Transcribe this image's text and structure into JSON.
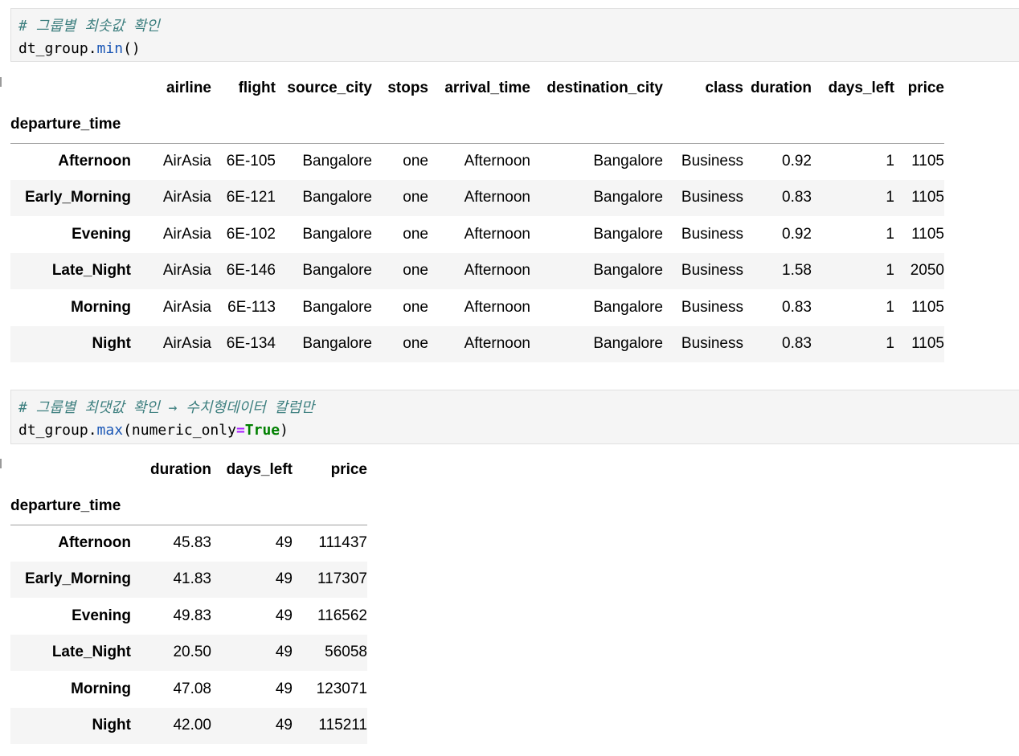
{
  "cell1": {
    "comment": "# 그룹별 최솟값 확인",
    "code_obj": "dt_group.",
    "code_fn": "min",
    "code_rest": "()"
  },
  "table1": {
    "columns": [
      "airline",
      "flight",
      "source_city",
      "stops",
      "arrival_time",
      "destination_city",
      "class",
      "duration",
      "days_left",
      "price"
    ],
    "index_name": "departure_time",
    "rows": [
      {
        "index": "Afternoon",
        "values": [
          "AirAsia",
          "6E-105",
          "Bangalore",
          "one",
          "Afternoon",
          "Bangalore",
          "Business",
          "0.92",
          "1",
          "1105"
        ]
      },
      {
        "index": "Early_Morning",
        "values": [
          "AirAsia",
          "6E-121",
          "Bangalore",
          "one",
          "Afternoon",
          "Bangalore",
          "Business",
          "0.83",
          "1",
          "1105"
        ]
      },
      {
        "index": "Evening",
        "values": [
          "AirAsia",
          "6E-102",
          "Bangalore",
          "one",
          "Afternoon",
          "Bangalore",
          "Business",
          "0.92",
          "1",
          "1105"
        ]
      },
      {
        "index": "Late_Night",
        "values": [
          "AirAsia",
          "6E-146",
          "Bangalore",
          "one",
          "Afternoon",
          "Bangalore",
          "Business",
          "1.58",
          "1",
          "2050"
        ]
      },
      {
        "index": "Morning",
        "values": [
          "AirAsia",
          "6E-113",
          "Bangalore",
          "one",
          "Afternoon",
          "Bangalore",
          "Business",
          "0.83",
          "1",
          "1105"
        ]
      },
      {
        "index": "Night",
        "values": [
          "AirAsia",
          "6E-134",
          "Bangalore",
          "one",
          "Afternoon",
          "Bangalore",
          "Business",
          "0.83",
          "1",
          "1105"
        ]
      }
    ]
  },
  "cell2": {
    "comment": "# 그룹별 최댓값 확인 → 수치형데이터 칼럼만",
    "code_obj": "dt_group.",
    "code_fn": "max",
    "code_arg": "(numeric_only",
    "code_op": "=",
    "code_kw": "True",
    "code_close": ")"
  },
  "table2": {
    "columns": [
      "duration",
      "days_left",
      "price"
    ],
    "index_name": "departure_time",
    "rows": [
      {
        "index": "Afternoon",
        "values": [
          "45.83",
          "49",
          "111437"
        ]
      },
      {
        "index": "Early_Morning",
        "values": [
          "41.83",
          "49",
          "117307"
        ]
      },
      {
        "index": "Evening",
        "values": [
          "49.83",
          "49",
          "116562"
        ]
      },
      {
        "index": "Late_Night",
        "values": [
          "20.50",
          "49",
          "56058"
        ]
      },
      {
        "index": "Morning",
        "values": [
          "47.08",
          "49",
          "123071"
        ]
      },
      {
        "index": "Night",
        "values": [
          "42.00",
          "49",
          "115211"
        ]
      }
    ]
  }
}
